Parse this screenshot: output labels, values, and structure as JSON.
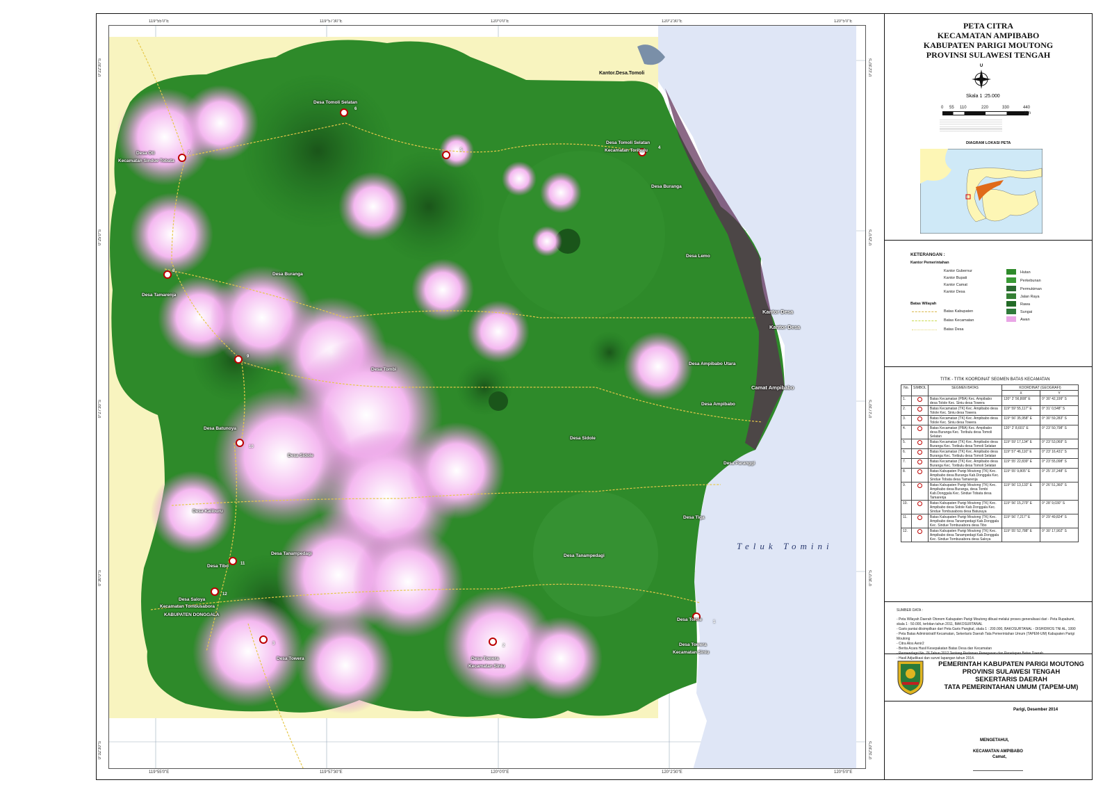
{
  "map": {
    "ticks_top": [
      "119°55'0\"E",
      "119°57'30\"E",
      "120°0'0\"E",
      "120°2'30\"E",
      "120°5'0\"E"
    ],
    "ticks_bottom": [
      "119°55'0\"E",
      "119°57'30\"E",
      "120°0'0\"E",
      "120°2'30\"E",
      "120°5'0\"E"
    ],
    "ticks_left": [
      "0°22'30\"S",
      "0°25'0\"S",
      "0°27'30\"S",
      "0°30'0\"S",
      "0°32'30\"S"
    ],
    "ticks_right": [
      "0°22'30\"S",
      "0°25'0\"S",
      "0°27'30\"S",
      "0°30'0\"S",
      "0°32'30\"S"
    ],
    "sea_label": "Teluk Tomini",
    "labels": {
      "kantor_desa_tomoli": "Kantor.Desa.Tomoli",
      "desa_tomoli_selatan": "Desa Tomoli Selatan",
      "desa_oti": "Desa Oti",
      "kec_sindue_tobata": "Kecamatan Sindue Tobata",
      "desa_tomoli_selatan_2": "Desa Tomoli Selatan",
      "kec_toribulu": "Kecamatan Toribulu",
      "desa_buranga_ne": "Desa Buranga",
      "desa_lemo": "Desa Lemo",
      "desa_buranga": "Desa Buranga",
      "desa_tamarenja": "Desa Tamarenja",
      "kantor_desa_1": "Kantor Desa",
      "kantor_desa_2": "Kantor Desa",
      "desa_ampibabo_utara": "Desa Ampibabo Utara",
      "desa_tombi": "Desa Tombi",
      "camat_ampibabo": "Camat Ampibabo",
      "desa_ampibabo": "Desa Ampibabo",
      "desa_batunoya": "Desa Batunoya",
      "desa_sidole_e": "Desa Sidole",
      "desa_sidole": "Desa Sidole",
      "desa_paranggi": "Desa Paranggi",
      "desa_kaliburu": "Desa Kaliburu",
      "desa_tiga": "Desa Tiga",
      "desa_tanampedagi_w": "Desa Tanampedagi",
      "desa_tanampedagi_e": "Desa Tanampedagi",
      "desa_tibo": "Desa Tibo",
      "desa_saloya": "Desa Saloya",
      "kec_tombusabora": "Kecamatan Tombusabora",
      "kab_donggala": "KABUPATEN DONGGALA",
      "desa_tolole": "Desa Tolole",
      "desa_towera_s": "Desa Towera",
      "kec_siniu": "Kecamatan Siniu",
      "desa_towera": "Desa Towera",
      "desa_towera_2": "Desa Towera",
      "kec_siniu_2": "Kecamatan Siniu"
    },
    "points": [
      "1",
      "2",
      "3",
      "4",
      "5",
      "6",
      "7",
      "8",
      "9",
      "10",
      "11",
      "12"
    ]
  },
  "panel": {
    "title_lines": [
      "PETA CITRA",
      "KECAMATAN AMPIBABO",
      "KABUPATEN PARIGI MOUTONG",
      "PROVINSI SULAWESI TENGAH"
    ],
    "north": "U",
    "scale_text": "Skala   1 :25.000",
    "scale_ticks": [
      "0",
      "55",
      "110",
      "220",
      "330",
      "440"
    ],
    "scale_unit": "Km",
    "diagram_title": "DIAGRAM LOKASI PETA",
    "keterangan": "KETERANGAN :",
    "kantor_pemerintahan": "Kantor Pemerintahan",
    "kantor_items": [
      "Kantor Gubernur",
      "Kantor Bupati",
      "Kantor Camat",
      "Kantor Desa"
    ],
    "batas_wilayah": "Batas Wilayah",
    "batas_items": [
      "Batas Kabupaten",
      "Batas Kecamatan",
      "Batas Desa"
    ],
    "landcover": [
      "Hutan",
      "Perkebunan",
      "Permukiman",
      "Jalan Raya",
      "Rawa",
      "Sungai",
      "Awan"
    ],
    "table_title": "TITIK - TITIK KOORDINAT SEGMEN BATAS KECAMATAN",
    "table_head": [
      "No.",
      "SIMBOL",
      "SEGMEN BATAS",
      "KOORDINAT  (GEOGRAFI)",
      "X",
      "Y"
    ],
    "rows": [
      {
        "no": "1.",
        "seg": "Batas Kecamatan (PBA) Kec. Ampibabo desa Tolole Kec. Siniu desa Towera",
        "x": "120° 2' 56,808\" E",
        "y": "0° 30' 42,199\" S"
      },
      {
        "no": "2.",
        "seg": "Batas Kecamatan (TK) Kec. Ampibabo desa Tolole Kec. Siniu desa Towera",
        "x": "119° 59' 55,117\" E",
        "y": "0° 31' 0,548\" S"
      },
      {
        "no": "3.",
        "seg": "Batas Kecamatan (TK) Kec. Ampibabo desa Tolole Kec. Siniu desa Towera",
        "x": "119° 56' 35,958\" E",
        "y": "0° 30' 59,283\" S"
      },
      {
        "no": "4.",
        "seg": "Batas Kecamatan (PBA) Kec. Ampibabo desa Buranga Kec. Toribulu desa Tomoli Selatan",
        "x": "120° 2' 8,601\" E",
        "y": "0° 23' 50,798\" S"
      },
      {
        "no": "5.",
        "seg": "Batas Kecamatan (TK) Kec. Ampibabo desa Buranga Kec. Toribulu desa Tomoli Selatan",
        "x": "119° 59' 17,134\" E",
        "y": "0° 23' 53,069\" S"
      },
      {
        "no": "6.",
        "seg": "Batas Kecamatan (TK) Kec. Ampibabo desa Buranga Kec. Toribulu desa Tomoli Selatan",
        "x": "119° 57' 46,110\" E",
        "y": "0° 23' 16,431\" S"
      },
      {
        "no": "7.",
        "seg": "Batas Kecamatan (TK) Kec. Ampibabo desa Buranga Kec. Toribulu desa Tomoli Selatan",
        "x": "119° 55' 22,839\" E",
        "y": "0° 23' 55,098\" S"
      },
      {
        "no": "8.",
        "seg": "Batas Kabupaten Parigi Moutong (TK) Kec. Ampibabo desa Buranga Kab.Donggala Kec. Sindue Tobata desa Tamarenja",
        "x": "119° 55' 9,805\" E",
        "y": "0° 25' 37,248\" S"
      },
      {
        "no": "9.",
        "seg": "Batas Kabupaten Parigi Moutong (TK) Kec. Ampibabo desa Buranga, desa Tombi Kab.Donggala Kec. Sindue Tobata desa Tamarenja",
        "x": "119° 56' 13,133\" E",
        "y": "0° 26' 51,360\" S"
      },
      {
        "no": "10.",
        "seg": "Batas Kabupaten Parigi Moutong (TK) Kec. Ampibabo desa Sidole Kab.Donggala Kec. Sindue Tombusabora desa Batusuya",
        "x": "119° 56' 15,279\" E",
        "y": "0° 28' 9,030\" S"
      },
      {
        "no": "11.",
        "seg": "Batas Kabupaten Parigi Moutong (TK) Kec. Ampibabo desa Tanampedagi Kab.Donggala Kec. Sindue Tombusabora desa Tibo",
        "x": "119° 56' 7,217\" E",
        "y": "0° 29' 49,824\" S"
      },
      {
        "no": "12.",
        "seg": "Batas Kabupaten Parigi Moutong (TK) Kec. Ampibabo desa Tanampedagi Kab.Donggala Kec. Sindue Tombusabora desa Saloya",
        "x": "119° 55' 52,788\" E",
        "y": "0° 30' 17,902\" S"
      }
    ],
    "sumber": "SUMBER DATA :",
    "sumber_lines": [
      "- Peta Wilayah Daerah Otonom Kabupaten Parigi Moutong dibuat melalui proses generalisasi dari - Peta Rupabumi,",
      "  skala 1 : 50.000, terbitan tahun 2011, BAKOSURTANAL",
      "- Garis pantai diisimpilkan dari Peta Garis Pangkal, skala 1 : 200.000, BAKOSURTANAL - DISHIDROS TNI AL, 1990",
      "- Peta Batas Administratif Kecamatan, Sekertaris Daerah Tata Pemerintahan Umum (TAPEM-UM) Kabupaten Parigi Moutong",
      "- Citra Alos Avnir2",
      "- Berita Acara Hasil Kesepakatan Batas Desa dan Kecamatan",
      "- Permendagri No. 76 Tahun 2012 Tentang Pedoman Penegasan dan Penetapan Batas Daerah.",
      "- Hasil Adjudikasi dan survei lapangan tahun 2014."
    ],
    "gov_lines": [
      "PEMERINTAH  KABUPATEN PARIGI MOUTONG",
      "PROVINSI SULAWESI TENGAH",
      "SEKERTARIS DAERAH",
      "TATA PEMERINTAHAN UMUM (TAPEM-UM)"
    ],
    "date": "Parigi,     Desember  2014",
    "mengetahui": "MENGETAHUI,",
    "kecamatan": "KECAMATAN  AMPIBABO",
    "camat": "Camat,"
  }
}
